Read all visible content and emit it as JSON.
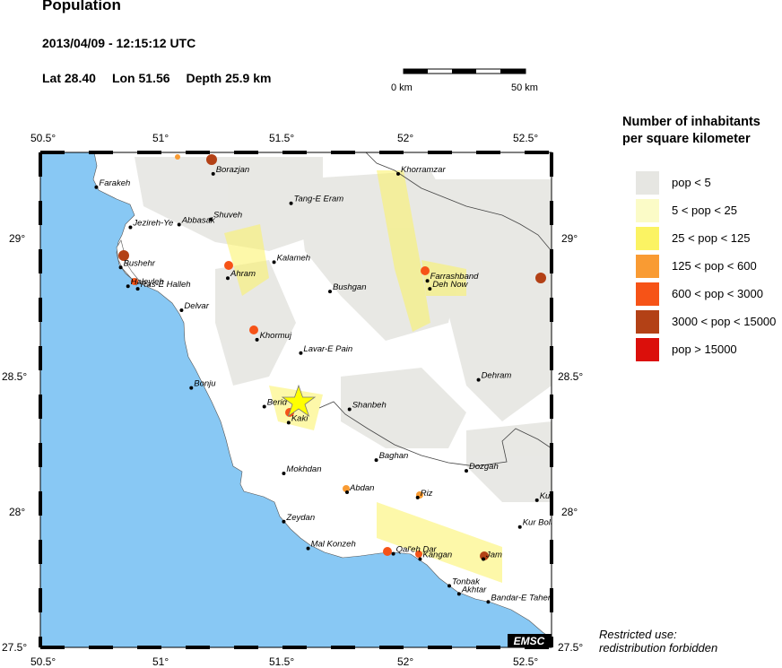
{
  "header": {
    "title": "Population",
    "datetime": "2013/04/09 - 12:15:12 UTC",
    "lat": "Lat 28.40",
    "lon": "Lon  51.56",
    "depth": "Depth  25.9 km"
  },
  "scale_bar": {
    "start_label": "0 km",
    "end_label": "50 km"
  },
  "map": {
    "lon_range": [
      50.5,
      52.6
    ],
    "lat_range": [
      27.5,
      29.35
    ],
    "x_ticks": [
      "50.5°",
      "51°",
      "51.5°",
      "52°",
      "52.5°"
    ],
    "y_ticks": [
      "27.5°",
      "28°",
      "28.5°",
      "29°"
    ],
    "epicenter": {
      "lon": 51.56,
      "lat": 28.4,
      "symbol": "yellow-star"
    },
    "cities": [
      {
        "name": "Borazjan",
        "lon": 51.21,
        "lat": 29.27
      },
      {
        "name": "Farakeh",
        "lon": 50.73,
        "lat": 29.22
      },
      {
        "name": "Khorramzar",
        "lon": 51.97,
        "lat": 29.27
      },
      {
        "name": "Tang-E Eram",
        "lon": 51.53,
        "lat": 29.16
      },
      {
        "name": "Jezireh-Ye",
        "lon": 50.87,
        "lat": 29.07
      },
      {
        "name": "Abbasak",
        "lon": 51.07,
        "lat": 29.08
      },
      {
        "name": "Shuveh",
        "lon": 51.2,
        "lat": 29.1
      },
      {
        "name": "Kalameh",
        "lon": 51.46,
        "lat": 28.94
      },
      {
        "name": "Bushehr",
        "lon": 50.83,
        "lat": 28.92
      },
      {
        "name": "Ahram",
        "lon": 51.27,
        "lat": 28.88
      },
      {
        "name": "Farrashband",
        "lon": 52.09,
        "lat": 28.87
      },
      {
        "name": "Deh Now",
        "lon": 52.1,
        "lat": 28.84
      },
      {
        "name": "Haleyleh",
        "lon": 50.86,
        "lat": 28.85
      },
      {
        "name": "Ras-E Halleh",
        "lon": 50.9,
        "lat": 28.84
      },
      {
        "name": "Bushgan",
        "lon": 51.69,
        "lat": 28.83
      },
      {
        "name": "Delvar",
        "lon": 51.08,
        "lat": 28.76
      },
      {
        "name": "Khormuj",
        "lon": 51.39,
        "lat": 28.65
      },
      {
        "name": "Lavar-E Pain",
        "lon": 51.57,
        "lat": 28.6
      },
      {
        "name": "Dehram",
        "lon": 52.3,
        "lat": 28.5
      },
      {
        "name": "Bonju",
        "lon": 51.12,
        "lat": 28.47
      },
      {
        "name": "Berid",
        "lon": 51.42,
        "lat": 28.4
      },
      {
        "name": "Shanbeh",
        "lon": 51.77,
        "lat": 28.39
      },
      {
        "name": "Kaki",
        "lon": 51.52,
        "lat": 28.34
      },
      {
        "name": "Baghan",
        "lon": 51.88,
        "lat": 28.2
      },
      {
        "name": "Dozgah",
        "lon": 52.25,
        "lat": 28.16
      },
      {
        "name": "Mokhdan",
        "lon": 51.5,
        "lat": 28.15
      },
      {
        "name": "Abdan",
        "lon": 51.76,
        "lat": 28.08
      },
      {
        "name": "Riz",
        "lon": 52.05,
        "lat": 28.06
      },
      {
        "name": "Kurdeh",
        "lon": 52.54,
        "lat": 28.05
      },
      {
        "name": "Zeydan",
        "lon": 51.5,
        "lat": 27.97
      },
      {
        "name": "Kur Bolagh",
        "lon": 52.47,
        "lat": 27.95
      },
      {
        "name": "Mal Konzeh",
        "lon": 51.6,
        "lat": 27.87
      },
      {
        "name": "Qal'eh Dar",
        "lon": 51.95,
        "lat": 27.85
      },
      {
        "name": "Kangan",
        "lon": 52.06,
        "lat": 27.83
      },
      {
        "name": "Jam",
        "lon": 52.32,
        "lat": 27.83
      },
      {
        "name": "Tonbak",
        "lon": 52.18,
        "lat": 27.73
      },
      {
        "name": "Akhtar",
        "lon": 52.22,
        "lat": 27.7
      },
      {
        "name": "Bandar-E Taheri",
        "lon": 52.34,
        "lat": 27.67
      }
    ]
  },
  "legend": {
    "title_line1": "Number of inhabitants",
    "title_line2": "per square kilometer",
    "items": [
      {
        "label": "pop < 5",
        "color": "#e6e6e2"
      },
      {
        "label": "5 < pop < 25",
        "color": "#fbfbc7"
      },
      {
        "label": "25 < pop < 125",
        "color": "#fbf363"
      },
      {
        "label": "125 < pop < 600",
        "color": "#f99b33"
      },
      {
        "label": "600 < pop < 3000",
        "color": "#f65317"
      },
      {
        "label": "3000 < pop < 15000",
        "color": "#b34116"
      },
      {
        "label": "pop > 15000",
        "color": "#db0f0b"
      }
    ]
  },
  "logo": "EMSC",
  "footer": {
    "line1": "Restricted use:",
    "line2": "redistribution forbidden"
  },
  "colors": {
    "sea": "#88c8f4",
    "land": "#ffffff",
    "star": "#ffff00"
  }
}
